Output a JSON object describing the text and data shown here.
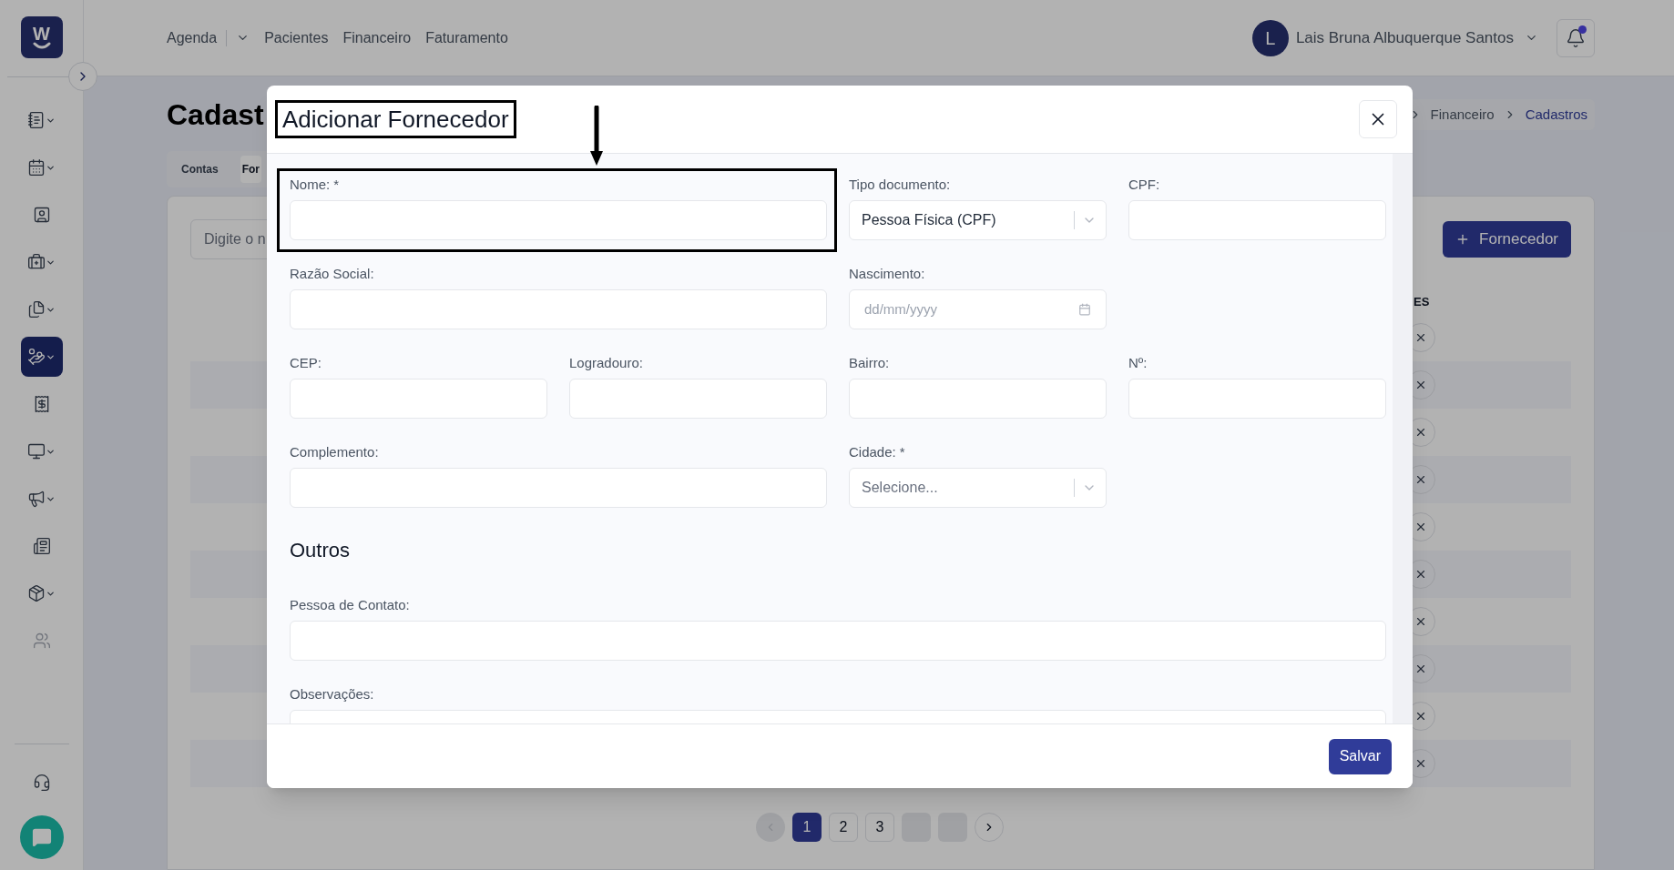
{
  "logo": {
    "text": "W"
  },
  "sidebar": {
    "items": [
      {
        "selected": false,
        "expandable": true,
        "disabled": false
      },
      {
        "selected": false,
        "expandable": true,
        "disabled": false
      },
      {
        "selected": false,
        "expandable": false,
        "disabled": false
      },
      {
        "selected": false,
        "expandable": true,
        "disabled": false
      },
      {
        "selected": false,
        "expandable": true,
        "disabled": false
      },
      {
        "selected": true,
        "expandable": true,
        "disabled": false
      },
      {
        "selected": false,
        "expandable": false,
        "disabled": false
      },
      {
        "selected": false,
        "expandable": true,
        "disabled": false
      },
      {
        "selected": false,
        "expandable": true,
        "disabled": false
      },
      {
        "selected": false,
        "expandable": false,
        "disabled": false
      },
      {
        "selected": false,
        "expandable": true,
        "disabled": false
      },
      {
        "selected": false,
        "expandable": false,
        "disabled": true
      }
    ]
  },
  "nav": [
    {
      "label": "Agenda",
      "kind": "dropdown"
    },
    {
      "label": "Pacientes",
      "kind": "link"
    },
    {
      "label": "Financeiro",
      "kind": "link"
    },
    {
      "label": "Faturamento",
      "kind": "link"
    }
  ],
  "user": {
    "initial": "L",
    "name": "Lais Bruna Albuquerque Santos"
  },
  "notifications": {
    "unread": true
  },
  "page": {
    "title": "Cadast",
    "breadcrumb": [
      {
        "label": "Financeiro",
        "selected": false
      },
      {
        "label": "Cadastros",
        "selected": true
      }
    ]
  },
  "tabs": [
    {
      "label": "Contas",
      "selected": false
    },
    {
      "label": "For",
      "selected": true
    }
  ],
  "search": {
    "placeholder": "Digite o n"
  },
  "add_button": {
    "label": "Fornecedor"
  },
  "table": {
    "columns": [
      {
        "label": "ES"
      }
    ],
    "rows": [
      {
        "removable": true
      },
      {
        "removable": true
      },
      {
        "removable": true
      },
      {
        "removable": true
      },
      {
        "removable": true
      },
      {
        "removable": true
      },
      {
        "removable": true
      },
      {
        "removable": true
      },
      {
        "removable": true
      },
      {
        "removable": true
      }
    ]
  },
  "pagination": [
    {
      "kind": "prev",
      "disabled": true
    },
    {
      "kind": "page",
      "label": "1",
      "selected": true
    },
    {
      "kind": "page",
      "label": "2",
      "selected": false
    },
    {
      "kind": "page",
      "label": "3",
      "selected": false
    },
    {
      "kind": "blank"
    },
    {
      "kind": "blank"
    },
    {
      "kind": "next",
      "disabled": false
    }
  ],
  "modal": {
    "title": "Adicionar Fornecedor",
    "title_highlighted": true,
    "rows": [
      [
        {
          "label": "Nome: *",
          "kind": "text",
          "highlighted": true
        },
        "",
        {
          "label": "Tipo documento:",
          "kind": "select",
          "value": "Pessoa Física (CPF)"
        },
        {
          "label": "CPF:",
          "kind": "text"
        }
      ],
      [
        {
          "label": "Razão Social:",
          "kind": "text"
        },
        "",
        {
          "label": "Nascimento:",
          "kind": "date",
          "placeholder": "dd/mm/yyyy"
        },
        ""
      ],
      [
        {
          "label": "CEP:",
          "kind": "text"
        },
        {
          "label": "Logradouro:",
          "kind": "text"
        },
        {
          "label": "Bairro:",
          "kind": "text"
        },
        {
          "label": "Nº:",
          "kind": "text"
        }
      ],
      [
        {
          "label": "Complemento:",
          "kind": "text"
        },
        "",
        {
          "label": "Cidade: *",
          "kind": "select",
          "placeholder": "Selecione..."
        },
        ""
      ]
    ],
    "section": {
      "title": "Outros",
      "fields": [
        {
          "label": "Pessoa de Contato:",
          "kind": "text"
        },
        {
          "label": "Observações:",
          "kind": "textarea"
        }
      ]
    },
    "save": {
      "label": "Salvar"
    }
  }
}
